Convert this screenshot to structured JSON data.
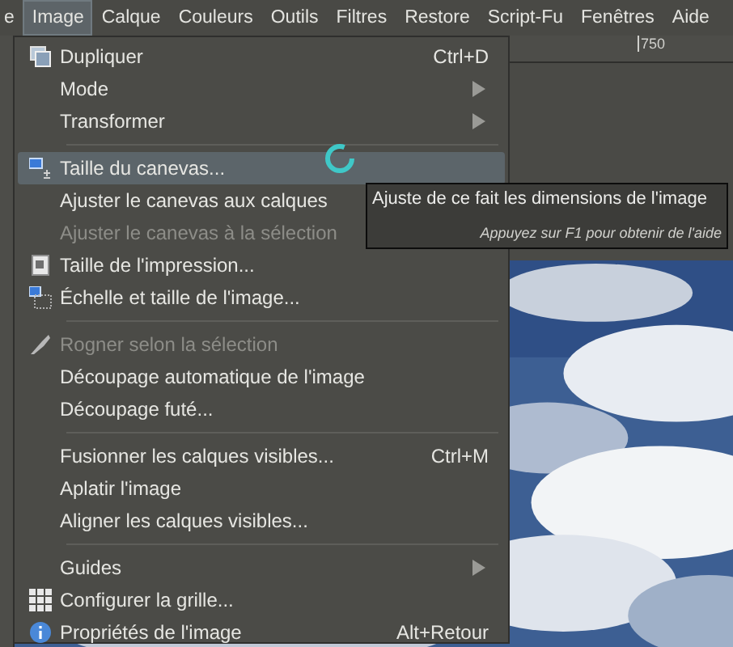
{
  "menubar": [
    {
      "label": "e",
      "selected": false
    },
    {
      "label": "Image",
      "selected": true
    },
    {
      "label": "Calque",
      "selected": false
    },
    {
      "label": "Couleurs",
      "selected": false
    },
    {
      "label": "Outils",
      "selected": false
    },
    {
      "label": "Filtres",
      "selected": false
    },
    {
      "label": "Restore",
      "selected": false
    },
    {
      "label": "Script-Fu",
      "selected": false
    },
    {
      "label": "Fenêtres",
      "selected": false
    },
    {
      "label": "Aide",
      "selected": false
    }
  ],
  "ruler": {
    "label": "750"
  },
  "menu": [
    {
      "kind": "item",
      "label": "Dupliquer",
      "shortcut": "Ctrl+D",
      "submenu": false,
      "disabled": false,
      "selected": false
    },
    {
      "kind": "item",
      "label": "Mode",
      "submenu": true,
      "disabled": false,
      "selected": false
    },
    {
      "kind": "item",
      "label": "Transformer",
      "submenu": true,
      "disabled": false,
      "selected": false
    },
    {
      "kind": "separator"
    },
    {
      "kind": "item",
      "label": "Taille du canevas...",
      "submenu": false,
      "disabled": false,
      "selected": true
    },
    {
      "kind": "item",
      "label": "Ajuster le canevas aux calques",
      "submenu": false,
      "disabled": false,
      "selected": false
    },
    {
      "kind": "item",
      "label": "Ajuster le canevas à la sélection",
      "submenu": false,
      "disabled": true,
      "selected": false
    },
    {
      "kind": "item",
      "label": "Taille de l'impression...",
      "submenu": false,
      "disabled": false,
      "selected": false
    },
    {
      "kind": "item",
      "label": "Échelle et taille de l'image...",
      "submenu": false,
      "disabled": false,
      "selected": false
    },
    {
      "kind": "separator"
    },
    {
      "kind": "item",
      "label": "Rogner selon la sélection",
      "submenu": false,
      "disabled": true,
      "selected": false
    },
    {
      "kind": "item",
      "label": "Découpage automatique de l'image",
      "submenu": false,
      "disabled": false,
      "selected": false
    },
    {
      "kind": "item",
      "label": "Découpage futé...",
      "submenu": false,
      "disabled": false,
      "selected": false
    },
    {
      "kind": "separator"
    },
    {
      "kind": "item",
      "label": "Fusionner les calques visibles...",
      "shortcut": "Ctrl+M",
      "submenu": false,
      "disabled": false,
      "selected": false
    },
    {
      "kind": "item",
      "label": "Aplatir l'image",
      "submenu": false,
      "disabled": false,
      "selected": false
    },
    {
      "kind": "item",
      "label": "Aligner les calques visibles...",
      "submenu": false,
      "disabled": false,
      "selected": false
    },
    {
      "kind": "separator"
    },
    {
      "kind": "item",
      "label": "Guides",
      "submenu": true,
      "disabled": false,
      "selected": false
    },
    {
      "kind": "item",
      "label": "Configurer la grille...",
      "submenu": false,
      "disabled": false,
      "selected": false
    },
    {
      "kind": "item",
      "label": "Propriétés de l'image",
      "shortcut": "Alt+Retour",
      "submenu": false,
      "disabled": false,
      "selected": false
    }
  ],
  "tooltip": {
    "text": "Ajuste de ce fait les dimensions de l'image",
    "hint": "Appuyez sur F1 pour obtenir de l'aide"
  }
}
